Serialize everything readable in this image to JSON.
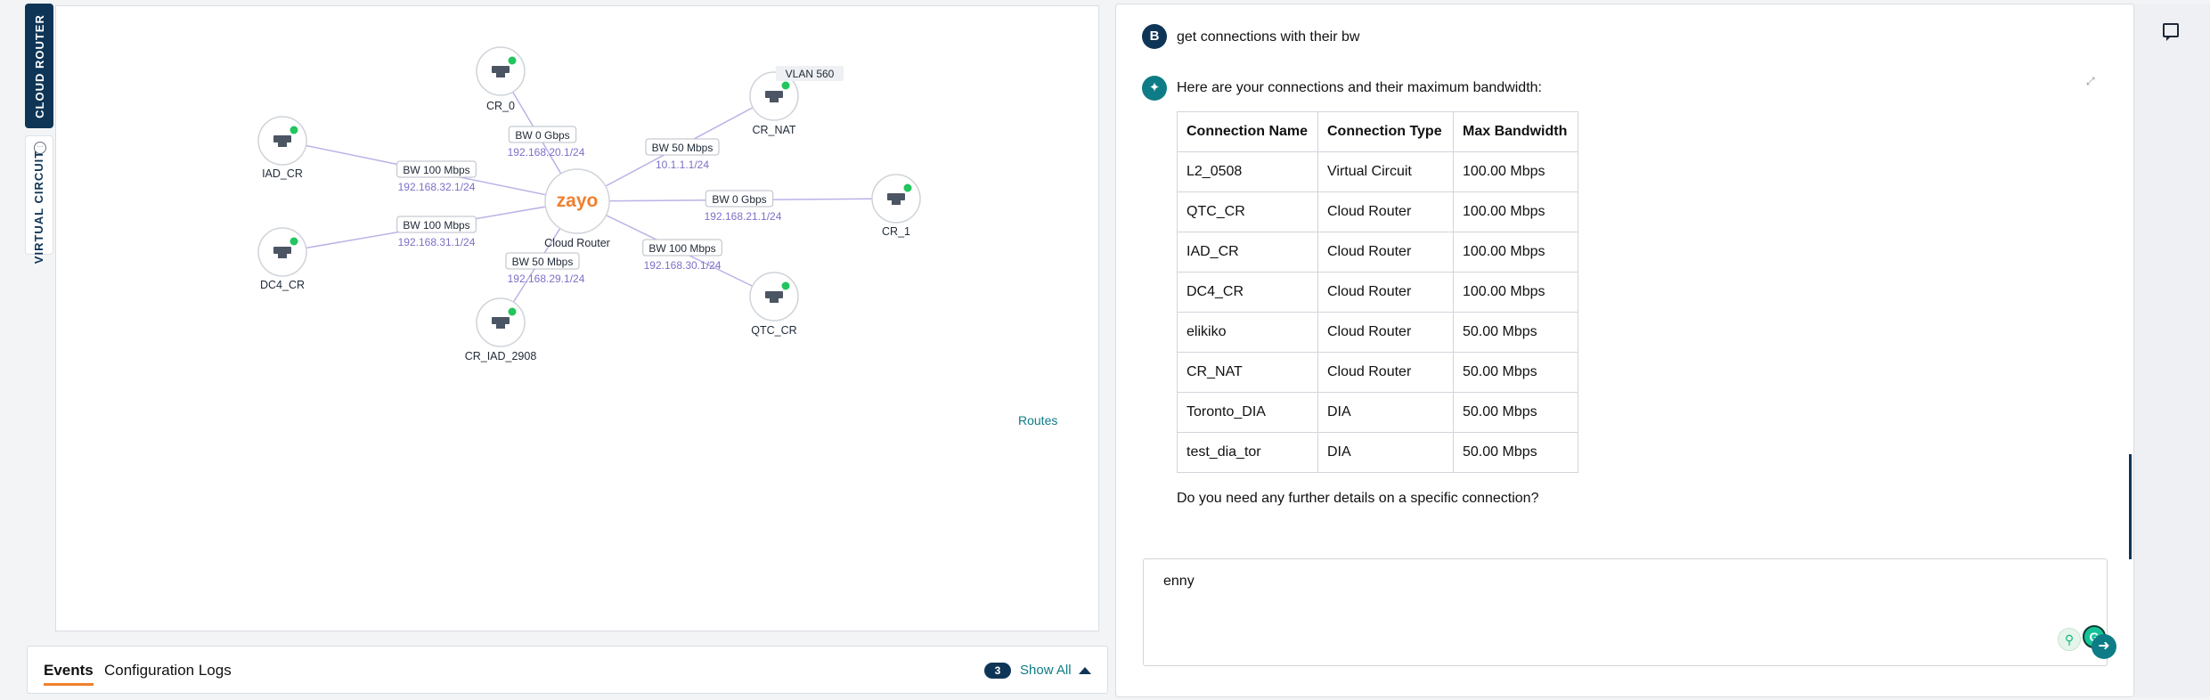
{
  "tabs": {
    "cloud_router": "CLOUD ROUTER",
    "virtual_circuit": "VIRTUAL CIRCUIT"
  },
  "topology": {
    "center": {
      "logo": "zayo",
      "label": "Cloud Router"
    },
    "nodes": [
      {
        "id": "CR_0",
        "status": "online"
      },
      {
        "id": "CR_NAT",
        "status": "online",
        "tag": "VLAN 560"
      },
      {
        "id": "IAD_CR",
        "status": "online"
      },
      {
        "id": "CR_1",
        "status": "online"
      },
      {
        "id": "DC4_CR",
        "status": "online"
      },
      {
        "id": "QTC_CR",
        "status": "online"
      },
      {
        "id": "CR_IAD_2908",
        "status": "online"
      }
    ],
    "links": [
      {
        "to": "CR_0",
        "bw": "BW 0 Gbps",
        "ip": "192.168.20.1/24"
      },
      {
        "to": "CR_NAT",
        "bw": "BW 50 Mbps",
        "ip": "10.1.1.1/24"
      },
      {
        "to": "IAD_CR",
        "bw": "BW 100 Mbps",
        "ip": "192.168.32.1/24"
      },
      {
        "to": "CR_1",
        "bw": "BW 0 Gbps",
        "ip": "192.168.21.1/24"
      },
      {
        "to": "DC4_CR",
        "bw": "BW 100 Mbps",
        "ip": "192.168.31.1/24"
      },
      {
        "to": "QTC_CR",
        "bw": "BW 100 Mbps",
        "ip": "192.168.30.1/24"
      },
      {
        "to": "CR_IAD_2908",
        "bw": "BW 50 Mbps",
        "ip": "192.168.29.1/24"
      }
    ],
    "routes_link": "Routes",
    "colors": {
      "online": "#22c55e",
      "link": "#b9b3e6",
      "ip_text": "#7b70c9",
      "node_border": "#cfd4da",
      "logo": "#f07f2c"
    }
  },
  "events": {
    "tab_events": "Events",
    "tab_config": "Configuration Logs",
    "count": "3",
    "show_all": "Show All"
  },
  "chat": {
    "user_initial": "B",
    "user_message": "get connections with their bw",
    "ai_intro": "Here are your connections and their maximum bandwidth:",
    "table_headers": [
      "Connection Name",
      "Connection Type",
      "Max Bandwidth"
    ],
    "table_rows": [
      [
        "L2_0508",
        "Virtual Circuit",
        "100.00 Mbps"
      ],
      [
        "QTC_CR",
        "Cloud Router",
        "100.00 Mbps"
      ],
      [
        "IAD_CR",
        "Cloud Router",
        "100.00 Mbps"
      ],
      [
        "DC4_CR",
        "Cloud Router",
        "100.00 Mbps"
      ],
      [
        "elikiko",
        "Cloud Router",
        "50.00 Mbps"
      ],
      [
        "CR_NAT",
        "Cloud Router",
        "50.00 Mbps"
      ],
      [
        "Toronto_DIA",
        "DIA",
        "50.00 Mbps"
      ],
      [
        "test_dia_tor",
        "DIA",
        "50.00 Mbps"
      ]
    ],
    "ai_followup": "Do you need any further details on a specific connection?",
    "input_value": "enny"
  }
}
